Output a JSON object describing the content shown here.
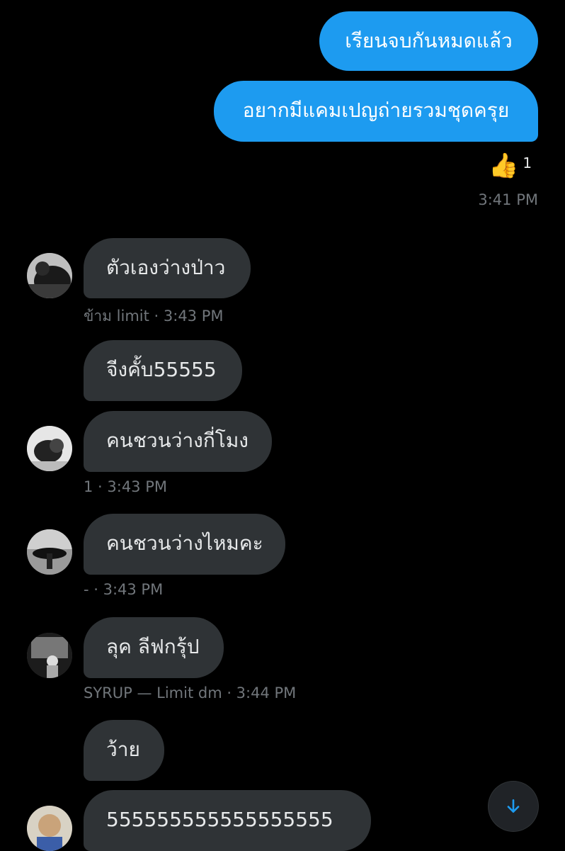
{
  "outgoing": [
    {
      "text": "เรียนจบกันหมดแล้ว"
    },
    {
      "text": "อยากมีแคมเปญถ่ายรวมชุดครุย"
    }
  ],
  "reaction": {
    "emoji": "👍",
    "count": "1"
  },
  "outgoing_time": "3:41 PM",
  "incoming": [
    {
      "text": "ตัวเองว่างป่าว",
      "meta": "ข้าม limit · 3:43 PM"
    },
    {
      "text": "จีงคั้บ55555"
    },
    {
      "text": "คนชวนว่างกี่โมง",
      "meta": "1 · 3:43 PM"
    },
    {
      "text": "คนชวนว่างไหมคะ",
      "meta": "- · 3:43 PM"
    },
    {
      "text": "ลุค ลีฟกรุ้ป",
      "meta": "SYRUP — Limit dm · 3:44 PM"
    },
    {
      "text": "ว้าย"
    },
    {
      "text": "555555555555555555"
    }
  ],
  "colors": {
    "accent": "#1d9bf0",
    "bubble_in": "#2f3336",
    "meta": "#71767b"
  },
  "scroll_button": {
    "icon": "arrow-down-icon"
  }
}
